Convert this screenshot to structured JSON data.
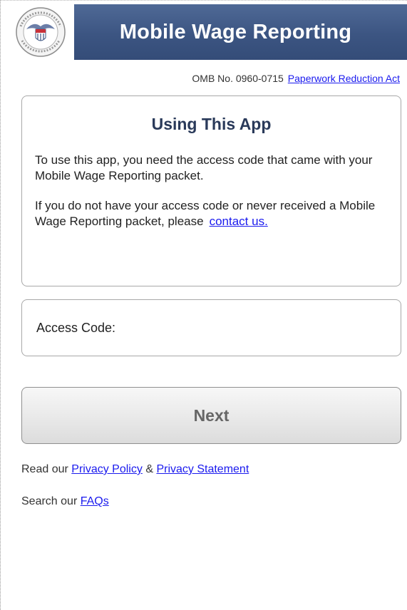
{
  "header": {
    "title": "Mobile Wage Reporting",
    "logo_icon": "ssa-seal-icon",
    "logo_text": "SOCIAL SECURITY ADMINISTRATION USA"
  },
  "omb": {
    "number_text": "OMB No. 0960-0715",
    "paperwork_link": "Paperwork Reduction Act"
  },
  "info": {
    "title": "Using This App",
    "paragraph1": "To use this app, you need the access code that came with your Mobile Wage Reporting packet.",
    "paragraph2_prefix": "If you do not have your access code or never received a Mobile Wage Reporting packet, please",
    "contact_link": "contact us."
  },
  "access": {
    "label": "Access Code:",
    "value": "",
    "placeholder": ""
  },
  "next_button": {
    "label": "Next"
  },
  "links": {
    "privacy_prefix": "Read our",
    "privacy_policy": "Privacy Policy",
    "ampersand": "&",
    "privacy_statement": "Privacy Statement",
    "faq_prefix": "Search our",
    "faqs": "FAQs"
  },
  "colors": {
    "header_bar": "#3c5582",
    "link": "#1a1aee",
    "title_text": "#2a3a5a"
  }
}
